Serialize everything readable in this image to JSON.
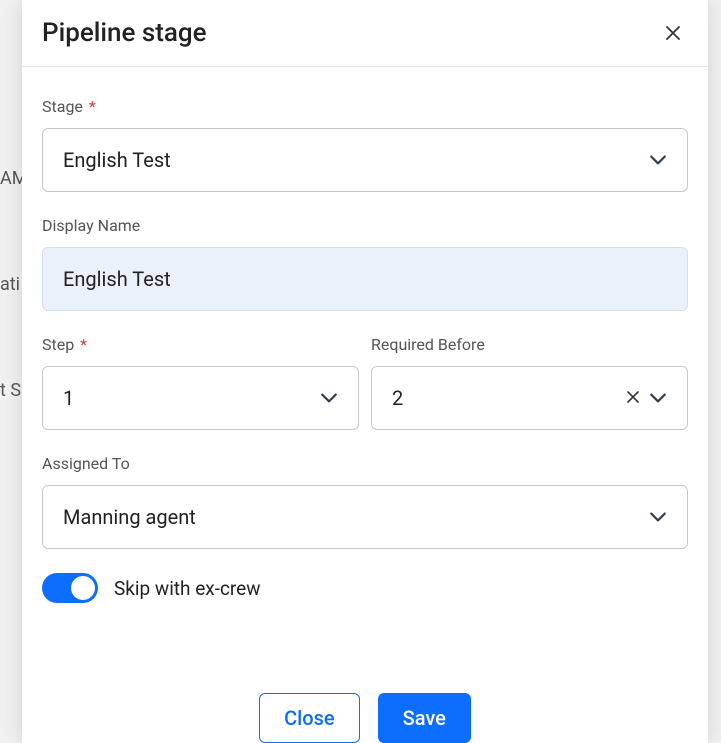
{
  "modal": {
    "title": "Pipeline stage",
    "fields": {
      "stage": {
        "label": "Stage",
        "required_mark": "*",
        "value": "English Test"
      },
      "display_name": {
        "label": "Display Name",
        "value": "English Test"
      },
      "step": {
        "label": "Step",
        "required_mark": "*",
        "value": "1"
      },
      "required_before": {
        "label": "Required Before",
        "value": "2"
      },
      "assigned_to": {
        "label": "Assigned To",
        "value": "Manning agent"
      },
      "skip_ex_crew": {
        "label": "Skip with ex-crew",
        "enabled": true
      }
    },
    "buttons": {
      "close": "Close",
      "save": "Save"
    }
  },
  "backdrop": {
    "text1": "AM",
    "text2": "ati",
    "text3": "t S"
  }
}
